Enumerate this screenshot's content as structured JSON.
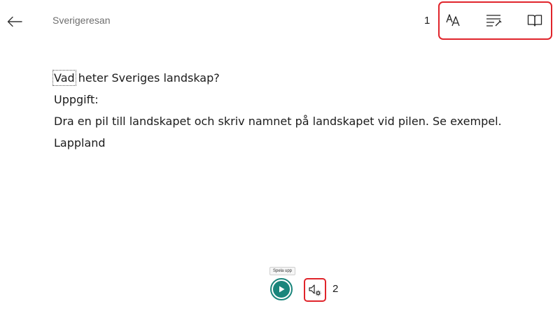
{
  "header": {
    "title": "Sverigeresan",
    "back_icon": "arrow-left-icon"
  },
  "callouts": {
    "toolbar": "1",
    "voice": "2"
  },
  "toolbar": {
    "items": [
      {
        "icon": "text-preferences-icon"
      },
      {
        "icon": "grammar-options-icon"
      },
      {
        "icon": "reading-preferences-icon"
      }
    ]
  },
  "content": {
    "first_word": "Vad",
    "first_line_rest": " heter Sveriges landskap?",
    "lines": [
      "Uppgift:",
      "Dra en pil till landskapet och skriv namnet på landskapet vid pilen. Se exempel.",
      "Lappland"
    ]
  },
  "player": {
    "tooltip": "Spela upp",
    "play_icon": "play-icon",
    "voice_settings_icon": "voice-settings-icon"
  },
  "colors": {
    "accent": "#19857b",
    "highlight": "#e0242b"
  }
}
